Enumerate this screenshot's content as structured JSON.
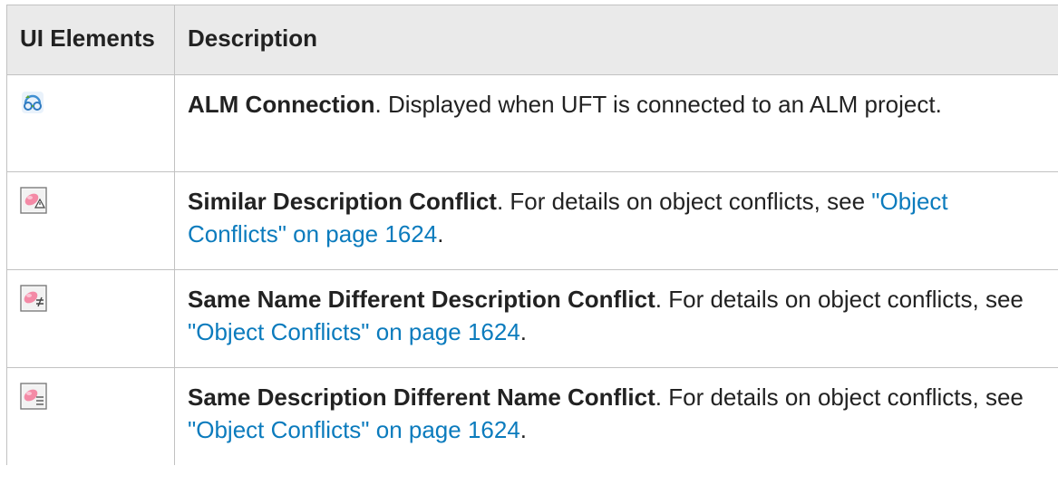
{
  "table": {
    "headers": [
      "UI Elements",
      "Description"
    ],
    "rows": [
      {
        "icon": "alm-connection-icon",
        "term": "ALM Connection",
        "text": ". Displayed when UFT is connected to an ALM project.",
        "link": "",
        "end": ""
      },
      {
        "icon": "similar-description-conflict-icon",
        "term": "Similar Description Conflict",
        "text": ". For details on object conflicts, see ",
        "link": "\"Object Conflicts\" on page 1624",
        "end": "."
      },
      {
        "icon": "same-name-different-description-conflict-icon",
        "term": "Same Name Different Description Conflict",
        "text": ". For details on object conflicts, see ",
        "link": "\"Object Conflicts\" on page 1624",
        "end": "."
      },
      {
        "icon": "same-description-different-name-conflict-icon",
        "term": "Same Description Different Name Conflict",
        "text": ". For details on object conflicts, see ",
        "link": "\"Object Conflicts\" on page 1624",
        "end": "."
      }
    ]
  },
  "colors": {
    "header_bg": "#eaeaea",
    "border": "#c2c2c2",
    "text": "#222222",
    "link": "#0b7bbd"
  }
}
